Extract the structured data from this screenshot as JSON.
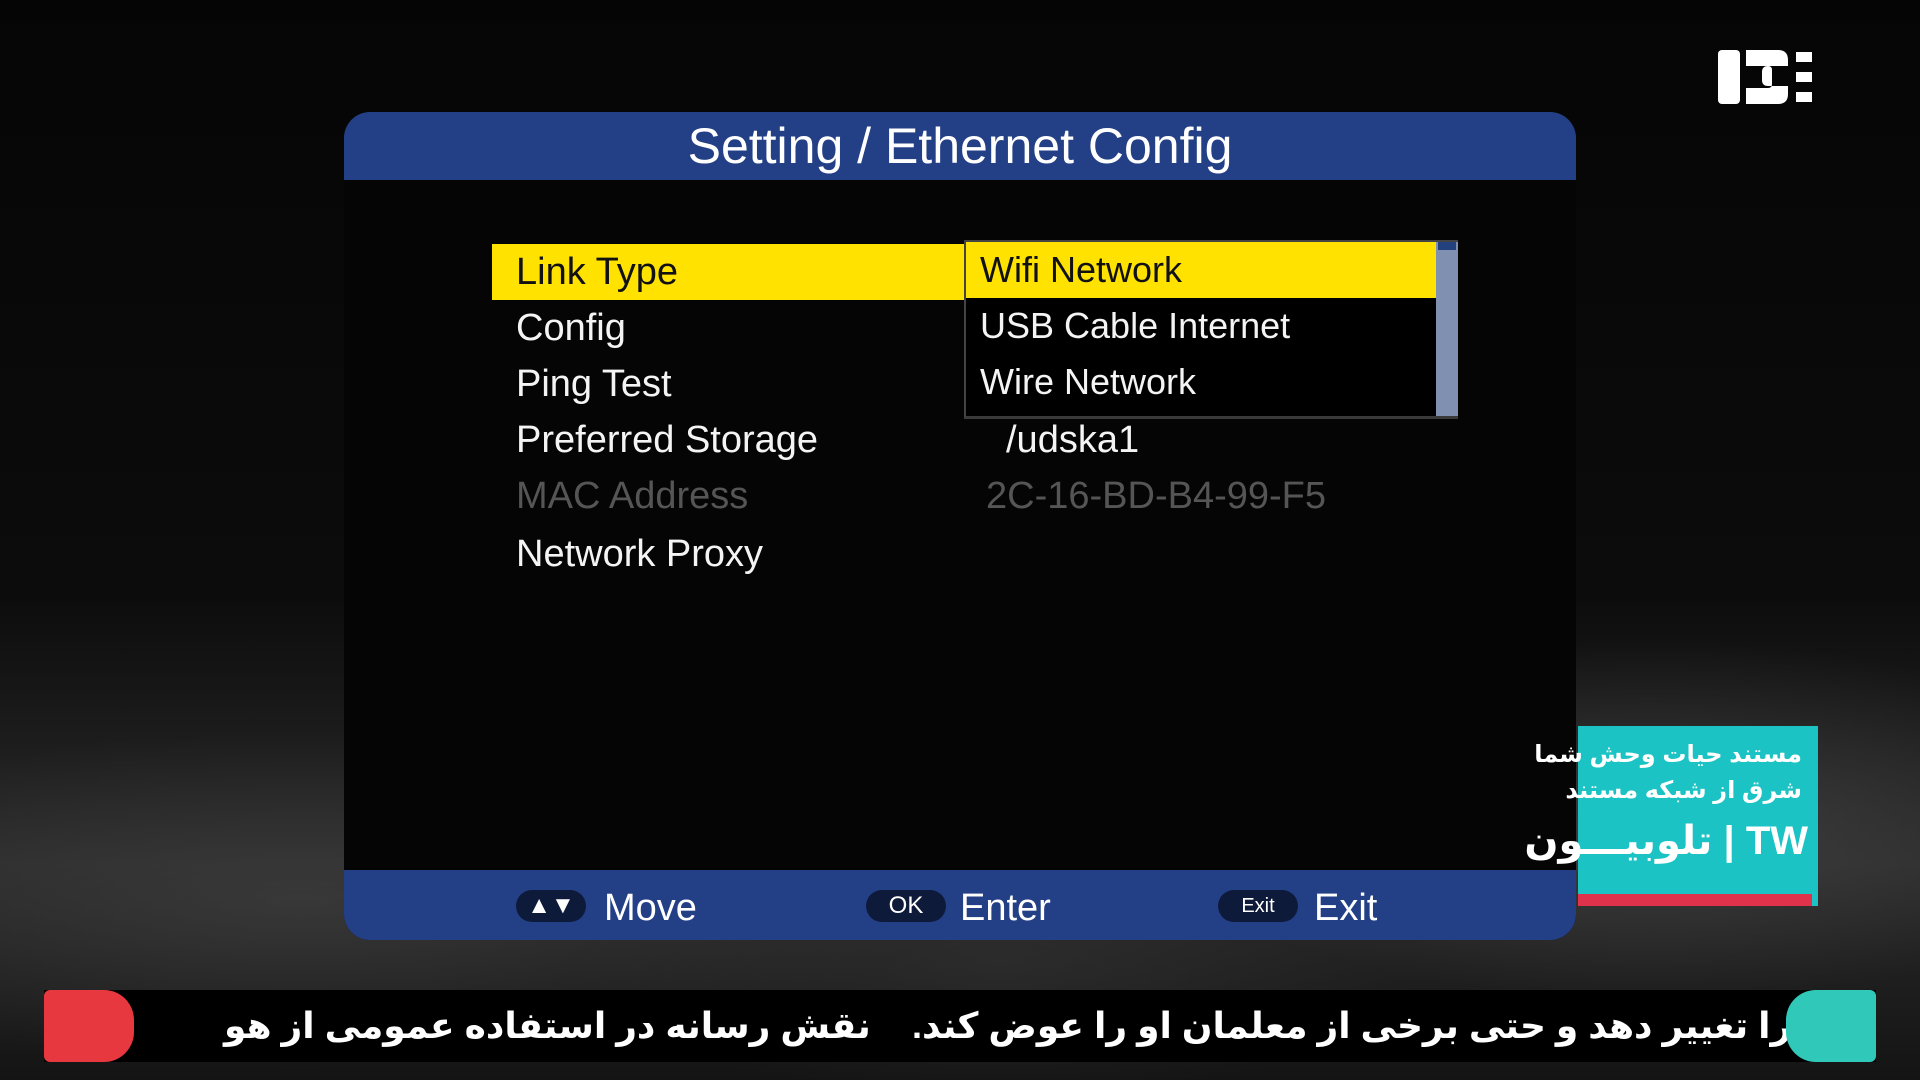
{
  "dialog": {
    "title": "Setting / Ethernet Config"
  },
  "menu": {
    "items": [
      {
        "label": "Link Type",
        "value": "",
        "selected": true,
        "disabled": false
      },
      {
        "label": "Config",
        "value": "",
        "selected": false,
        "disabled": false
      },
      {
        "label": "Ping Test",
        "value": "",
        "selected": false,
        "disabled": false
      },
      {
        "label": "Preferred Storage",
        "value": "/udska1",
        "selected": false,
        "disabled": false
      },
      {
        "label": "MAC Address",
        "value": "2C-16-BD-B4-99-F5",
        "selected": false,
        "disabled": true
      },
      {
        "label": "Network Proxy",
        "value": "",
        "selected": false,
        "disabled": false
      }
    ]
  },
  "dropdown": {
    "options": [
      {
        "label": "Wifi Network",
        "selected": true
      },
      {
        "label": "USB Cable Internet",
        "selected": false
      },
      {
        "label": "Wire Network",
        "selected": false
      }
    ]
  },
  "footer": {
    "move": {
      "key": "▲▼",
      "label": "Move"
    },
    "enter": {
      "key": "OK",
      "label": "Enter"
    },
    "exit": {
      "key": "Exit",
      "label": "Exit"
    }
  },
  "promo": {
    "line1": "مستند حیات وحش شما",
    "line2": "شرق از شبکه مستند",
    "brand": "TW | تلوبیـــون"
  },
  "ticker": {
    "text_left": "نقش رسانه در استفاده عمومی از هو",
    "text_right": "را تغییر دهد و حتی برخی از معلمان او را عوض کند."
  },
  "colors": {
    "header_blue": "#233f86",
    "highlight_yellow": "#ffe200",
    "promo_cyan": "#1cc3c4",
    "ticker_red": "#e8383f"
  }
}
